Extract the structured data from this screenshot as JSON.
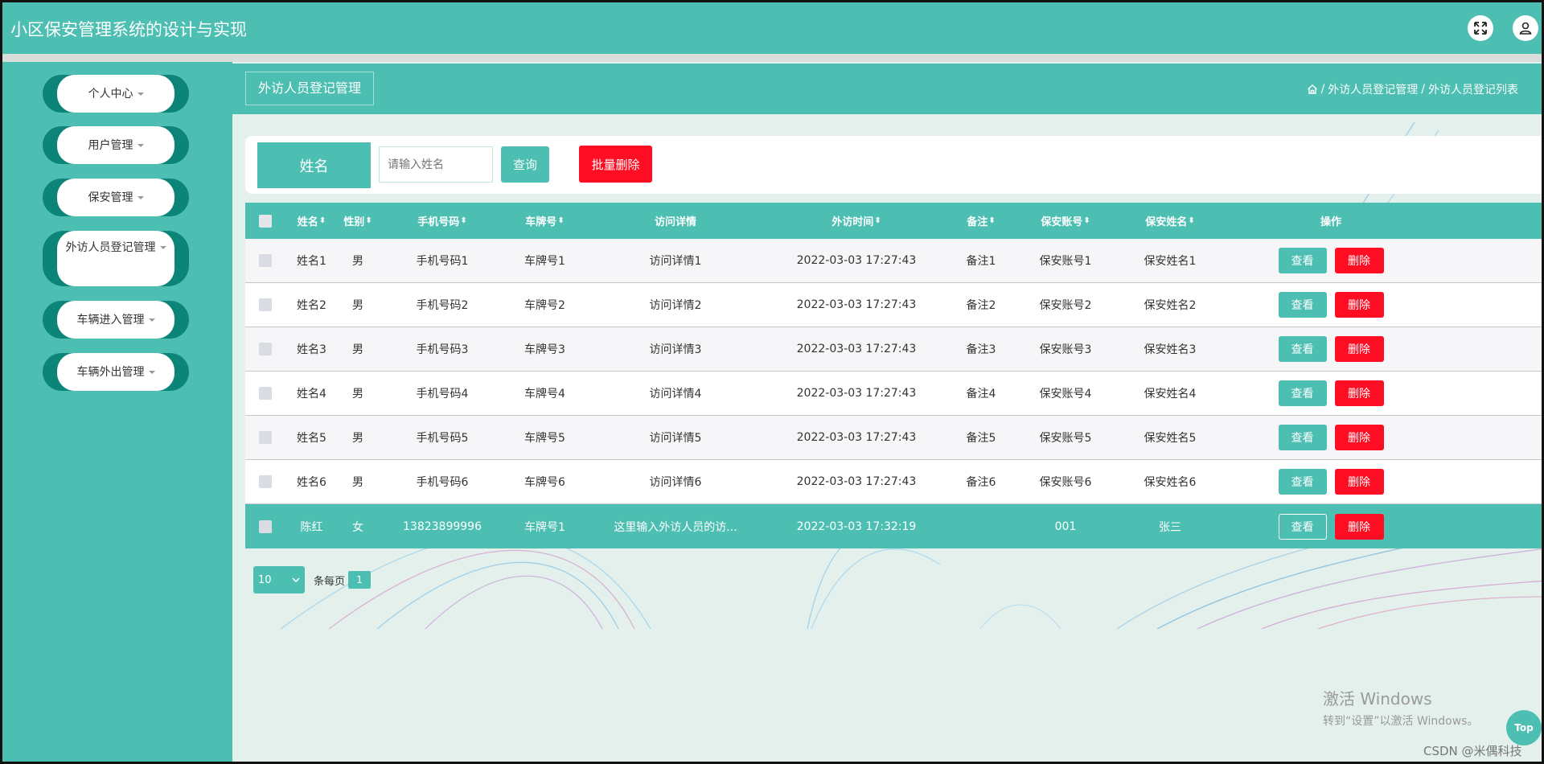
{
  "app": {
    "title": "小区保安管理系统的设计与实现"
  },
  "header": {
    "fullscreen_icon": "expand-icon",
    "user_icon": "user-icon"
  },
  "sidebar": {
    "items": [
      {
        "label": "个人中心"
      },
      {
        "label": "用户管理"
      },
      {
        "label": "保安管理"
      },
      {
        "label": "外访人员登记管理"
      },
      {
        "label": "车辆进入管理"
      },
      {
        "label": "车辆外出管理"
      }
    ]
  },
  "breadcrumb": {
    "page_title": "外访人员登记管理",
    "home_icon": "home-icon",
    "sep": "/",
    "level1": "外访人员登记管理",
    "level2": "外访人员登记列表"
  },
  "search": {
    "label": "姓名",
    "placeholder": "请输入姓名",
    "query_button": "查询",
    "bulk_delete_button": "批量删除"
  },
  "table": {
    "columns": {
      "name": "姓名",
      "gender": "性别",
      "phone": "手机号码",
      "plate": "车牌号",
      "details": "访问详情",
      "visit_time": "外访时间",
      "remark": "备注",
      "guard_account": "保安账号",
      "guard_name": "保安姓名",
      "actions": "操作"
    },
    "sort_glyph": "⬍",
    "view_label": "查看",
    "delete_label": "删除",
    "rows": [
      {
        "name": "姓名1",
        "gender": "男",
        "phone": "手机号码1",
        "plate": "车牌号1",
        "details": "访问详情1",
        "visit_time": "2022-03-03 17:27:43",
        "remark": "备注1",
        "guard_account": "保安账号1",
        "guard_name": "保安姓名1"
      },
      {
        "name": "姓名2",
        "gender": "男",
        "phone": "手机号码2",
        "plate": "车牌号2",
        "details": "访问详情2",
        "visit_time": "2022-03-03 17:27:43",
        "remark": "备注2",
        "guard_account": "保安账号2",
        "guard_name": "保安姓名2"
      },
      {
        "name": "姓名3",
        "gender": "男",
        "phone": "手机号码3",
        "plate": "车牌号3",
        "details": "访问详情3",
        "visit_time": "2022-03-03 17:27:43",
        "remark": "备注3",
        "guard_account": "保安账号3",
        "guard_name": "保安姓名3"
      },
      {
        "name": "姓名4",
        "gender": "男",
        "phone": "手机号码4",
        "plate": "车牌号4",
        "details": "访问详情4",
        "visit_time": "2022-03-03 17:27:43",
        "remark": "备注4",
        "guard_account": "保安账号4",
        "guard_name": "保安姓名4"
      },
      {
        "name": "姓名5",
        "gender": "男",
        "phone": "手机号码5",
        "plate": "车牌号5",
        "details": "访问详情5",
        "visit_time": "2022-03-03 17:27:43",
        "remark": "备注5",
        "guard_account": "保安账号5",
        "guard_name": "保安姓名5"
      },
      {
        "name": "姓名6",
        "gender": "男",
        "phone": "手机号码6",
        "plate": "车牌号6",
        "details": "访问详情6",
        "visit_time": "2022-03-03 17:27:43",
        "remark": "备注6",
        "guard_account": "保安账号6",
        "guard_name": "保安姓名6"
      },
      {
        "name": "陈红",
        "gender": "女",
        "phone": "13823899996",
        "plate": "车牌号1",
        "details": "这里输入外访人员的访...",
        "visit_time": "2022-03-03 17:32:19",
        "remark": "",
        "guard_account": "001",
        "guard_name": "张三"
      }
    ]
  },
  "pagination": {
    "page_size": "10",
    "per_page_label": "条每页",
    "current_page": "1"
  },
  "watermark": {
    "line1": "激活 Windows",
    "line2": "转到“设置”以激活 Windows。"
  },
  "top_button": "Top",
  "csdn_mark": "CSDN @米偶科技",
  "colors": {
    "primary": "#4cbfb2",
    "danger": "#ff0d23",
    "sidebar_dark": "#0c8578"
  }
}
